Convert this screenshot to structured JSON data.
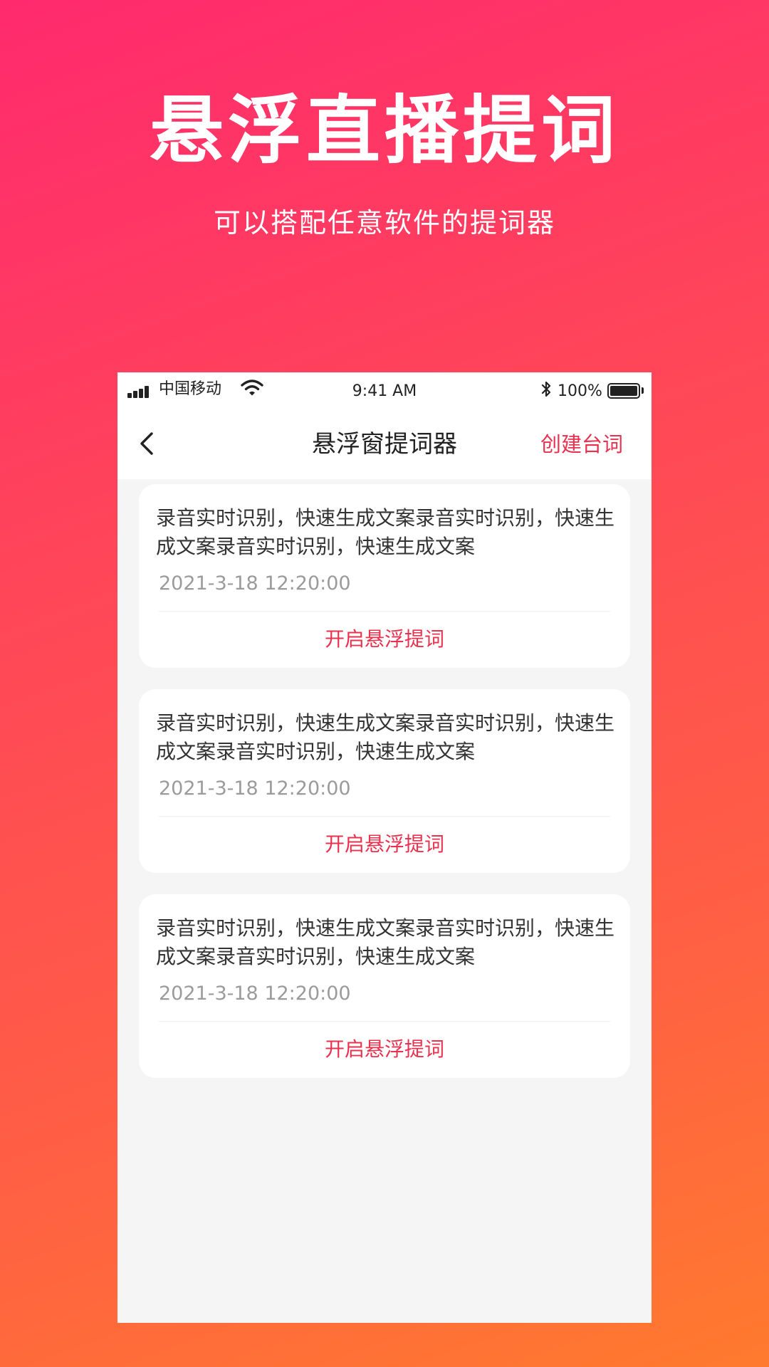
{
  "hero": {
    "title": "悬浮直播提词",
    "subtitle": "可以搭配任意软件的提词器"
  },
  "status_bar": {
    "carrier": "中国移动",
    "time": "9:41 AM",
    "battery": "100%"
  },
  "nav": {
    "title": "悬浮窗提词器",
    "create_label": "创建台词"
  },
  "cards": [
    {
      "text": "录音实时识别，快速生成文案录音实时识别，快速生成文案录音实时识别，快速生成文案",
      "date": "2021-3-18 12:20:00",
      "action": "开启悬浮提词"
    },
    {
      "text": "录音实时识别，快速生成文案录音实时识别，快速生成文案录音实时识别，快速生成文案",
      "date": "2021-3-18 12:20:00",
      "action": "开启悬浮提词"
    },
    {
      "text": "录音实时识别，快速生成文案录音实时识别，快速生成文案录音实时识别，快速生成文案",
      "date": "2021-3-18 12:20:00",
      "action": "开启悬浮提词"
    }
  ],
  "colors": {
    "accent": "#e8314e",
    "gradient_top": "#ff2a6e",
    "gradient_bottom": "#ff7a2e"
  },
  "icons": {
    "back": "chevron-left-icon",
    "signal": "signal-bars-icon",
    "wifi": "wifi-icon",
    "bluetooth": "bluetooth-icon",
    "battery": "battery-icon"
  }
}
